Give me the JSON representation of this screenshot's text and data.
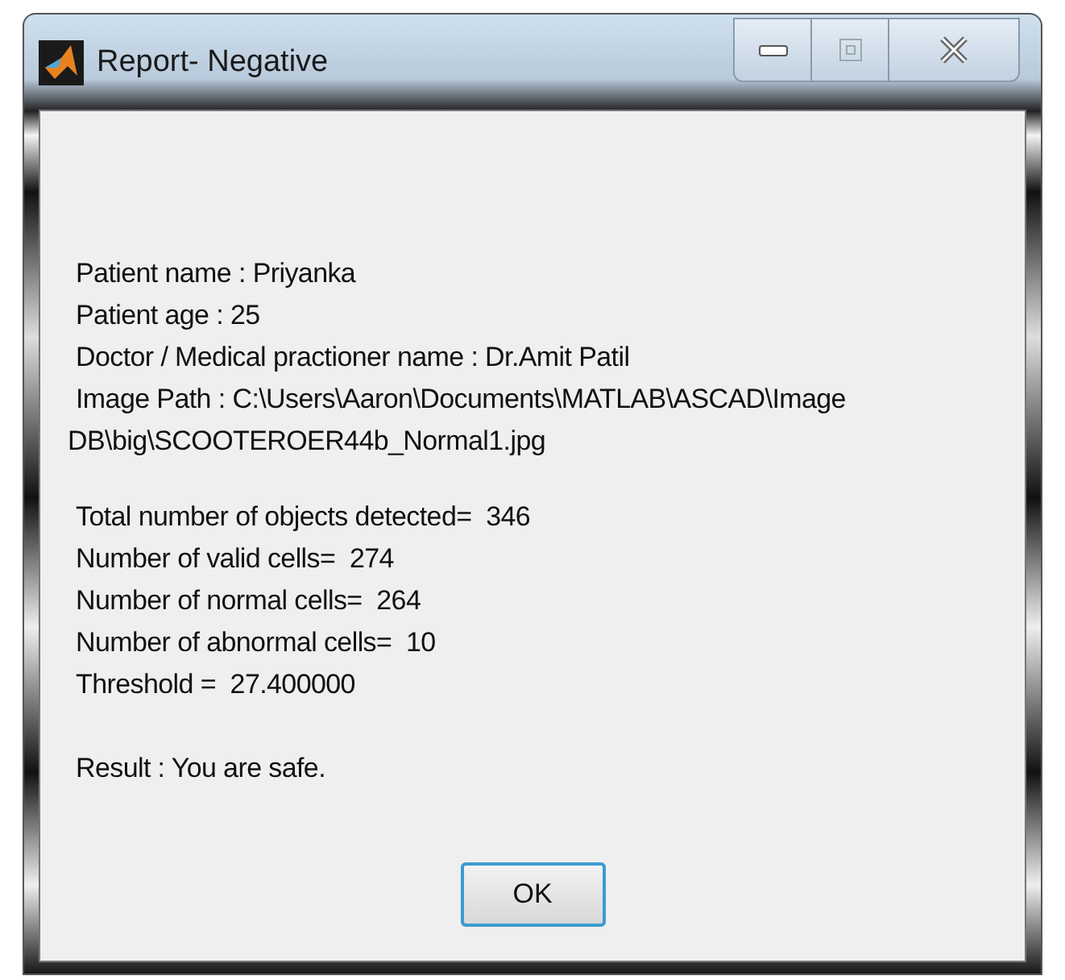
{
  "window": {
    "title": "Report- Negative"
  },
  "patient_info": [
    "Patient name : Priyanka",
    "Patient age : 25",
    "Doctor / Medical practioner name : Dr.Amit Patil",
    "Image Path : C:\\Users\\Aaron\\Documents\\MATLAB\\ASCAD\\Image",
    "DB\\big\\SCOOTEROER44b_Normal1.jpg"
  ],
  "statistics": [
    "Total number of objects detected=  346",
    "Number of valid cells=  274",
    "Number of normal cells=  264",
    "Number of abnormal cells=  10",
    "Threshold =  27.400000"
  ],
  "result": "Result : You are safe.",
  "buttons": [
    "OK"
  ]
}
